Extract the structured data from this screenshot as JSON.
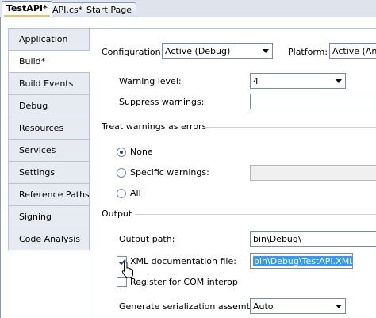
{
  "doc_tabs": [
    {
      "label": "TestAPI*",
      "active": true
    },
    {
      "label": "API.cs*",
      "active": false
    },
    {
      "label": "Start Page",
      "active": false
    }
  ],
  "nav": {
    "items": [
      {
        "label": "Application"
      },
      {
        "label": "Build*"
      },
      {
        "label": "Build Events"
      },
      {
        "label": "Debug"
      },
      {
        "label": "Resources"
      },
      {
        "label": "Services"
      },
      {
        "label": "Settings"
      },
      {
        "label": "Reference Paths"
      },
      {
        "label": "Signing"
      },
      {
        "label": "Code Analysis"
      }
    ],
    "active_index": 1
  },
  "config": {
    "configuration_label": "Configuration:",
    "configuration_value": "Active (Debug)",
    "platform_label": "Platform:",
    "platform_value": "Active (Any"
  },
  "errors_warnings": {
    "warning_level_label": "Warning level:",
    "warning_level_value": "4",
    "suppress_label": "Suppress warnings:",
    "suppress_value": ""
  },
  "treat_warnings": {
    "heading": "Treat warnings as errors",
    "options": [
      {
        "label": "None",
        "selected": true
      },
      {
        "label": "Specific warnings:",
        "selected": false
      },
      {
        "label": "All",
        "selected": false
      }
    ],
    "specific_value": ""
  },
  "output": {
    "heading": "Output",
    "output_path_label": "Output path:",
    "output_path_value": "bin\\Debug\\",
    "xml_doc_label": "XML documentation file:",
    "xml_doc_checked": true,
    "xml_doc_value": "bin\\Debug\\TestAPI.XML",
    "com_interop_label": "Register for COM interop",
    "com_interop_checked": false,
    "serialization_label": "Generate serialization assembly:",
    "serialization_value": "Auto"
  },
  "colors": {
    "selection": "#3399ff",
    "tab_active_marker": "#e5c365",
    "frame_border": "#8a9ab5"
  }
}
